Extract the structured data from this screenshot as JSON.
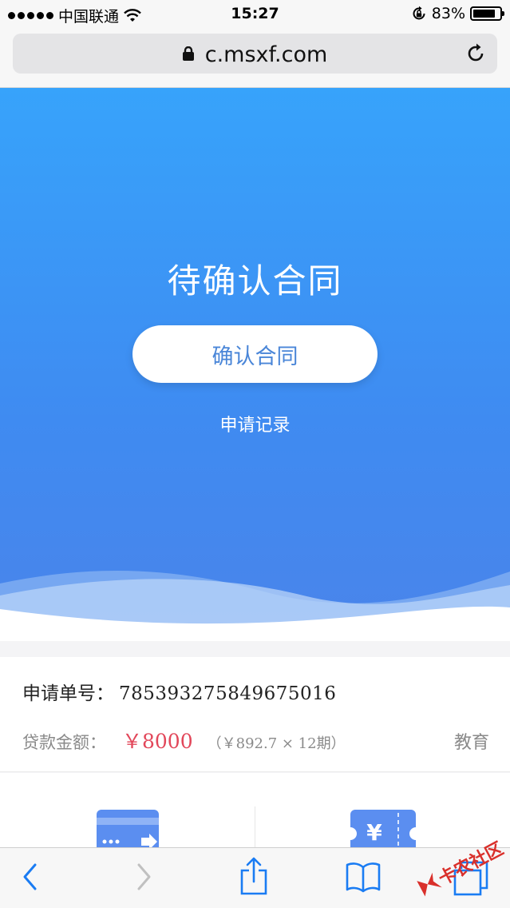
{
  "status_bar": {
    "carrier": "中国联通",
    "time": "15:27",
    "battery": "83%",
    "battery_level": 0.83,
    "icons": [
      "signal-dots-icon",
      "wifi-icon",
      "rotation-lock-icon",
      "battery-icon"
    ]
  },
  "browser": {
    "url": "c.msxf.com",
    "icons": [
      "lock-icon",
      "reload-icon"
    ]
  },
  "hero": {
    "title": "待确认合同",
    "confirm_button": "确认合同",
    "records_link": "申请记录",
    "colors": {
      "top": "#37a3fb",
      "bottom": "#4a84ea",
      "button_text": "#4a86d8"
    }
  },
  "info": {
    "order_label": "申请单号：",
    "order_number": "785393275849675016",
    "amount_label": "贷款金额：",
    "amount": "￥8000",
    "installment": "（￥892.7 × 12期）",
    "purpose": "教育",
    "amount_color": "#e2475a"
  },
  "bottom_icons": [
    "bank-card-icon",
    "yuan-coupon-icon"
  ],
  "toolbar": {
    "icons": [
      "back-icon",
      "forward-icon",
      "share-icon",
      "bookmarks-icon",
      "tabs-icon"
    ]
  },
  "watermark": {
    "text": "卡农社区",
    "icon": "kanong-logo-icon"
  }
}
